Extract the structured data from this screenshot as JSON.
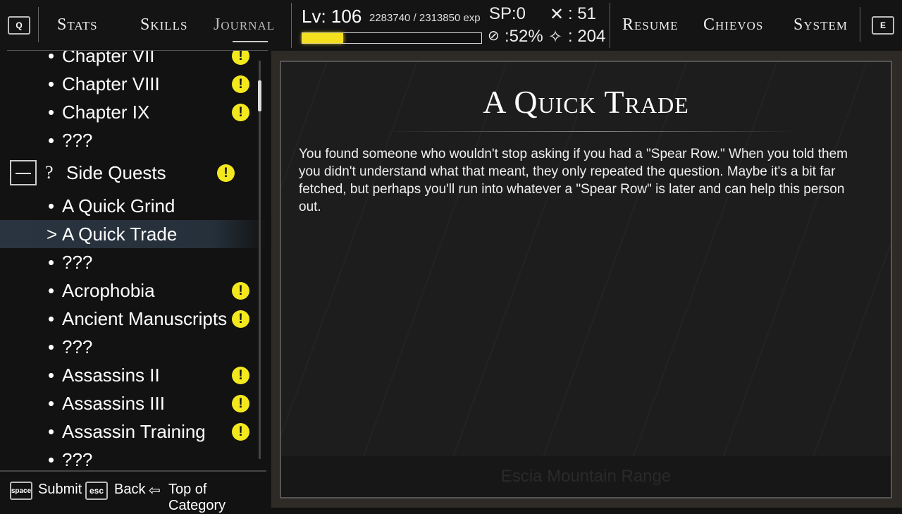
{
  "topbar": {
    "q_key": "Q",
    "e_key": "E",
    "tabs": [
      "Stats",
      "Skills",
      "Journal"
    ],
    "right_tabs": [
      "Resume",
      "Chievos",
      "System"
    ],
    "active_tab": "Journal",
    "level": "Lv: 106",
    "exp": "2283740 / 2313850 exp",
    "exp_progress": 0.228374,
    "sp": "SP:0",
    "crossed_swords": ": 51",
    "feather": ":52%",
    "figure": ": 204",
    "accent": "#f5e020"
  },
  "list": {
    "items": [
      {
        "label": "Chapter VII",
        "type": "item",
        "badge": true
      },
      {
        "label": "Chapter VIII",
        "type": "item",
        "badge": true
      },
      {
        "label": "Chapter IX",
        "type": "item",
        "badge": true
      },
      {
        "label": "???",
        "type": "item",
        "badge": false
      },
      {
        "label": "Side Quests",
        "type": "category",
        "badge": true
      },
      {
        "label": "A Quick Grind",
        "type": "item",
        "badge": false
      },
      {
        "label": "A Quick Trade",
        "type": "selected",
        "badge": false
      },
      {
        "label": "???",
        "type": "item",
        "badge": false
      },
      {
        "label": "Acrophobia",
        "type": "item",
        "badge": true
      },
      {
        "label": "Ancient Manuscripts",
        "type": "item",
        "badge": true
      },
      {
        "label": "???",
        "type": "item",
        "badge": false
      },
      {
        "label": "Assassins II",
        "type": "item",
        "badge": true
      },
      {
        "label": "Assassins III",
        "type": "item",
        "badge": true
      },
      {
        "label": "Assassin Training",
        "type": "item",
        "badge": true
      },
      {
        "label": "???",
        "type": "item",
        "badge": false
      }
    ],
    "badge_glyph": "!",
    "bullet": "•",
    "selected_marker": ">",
    "category_icon": "?"
  },
  "footer": {
    "space_key": "space",
    "submit": "Submit",
    "esc_key": "esc",
    "back": "Back",
    "top": "Top of Category"
  },
  "quest": {
    "title": "A Quick Trade",
    "body": "You found someone who wouldn't stop asking if you had a \"Spear Row.\" When you told them you didn't understand what that meant, they only repeated the question. Maybe it's a bit far fetched, but perhaps you'll run into whatever a \"Spear Row\" is later and can help this person out.",
    "location": "Escia Mountain Range"
  }
}
